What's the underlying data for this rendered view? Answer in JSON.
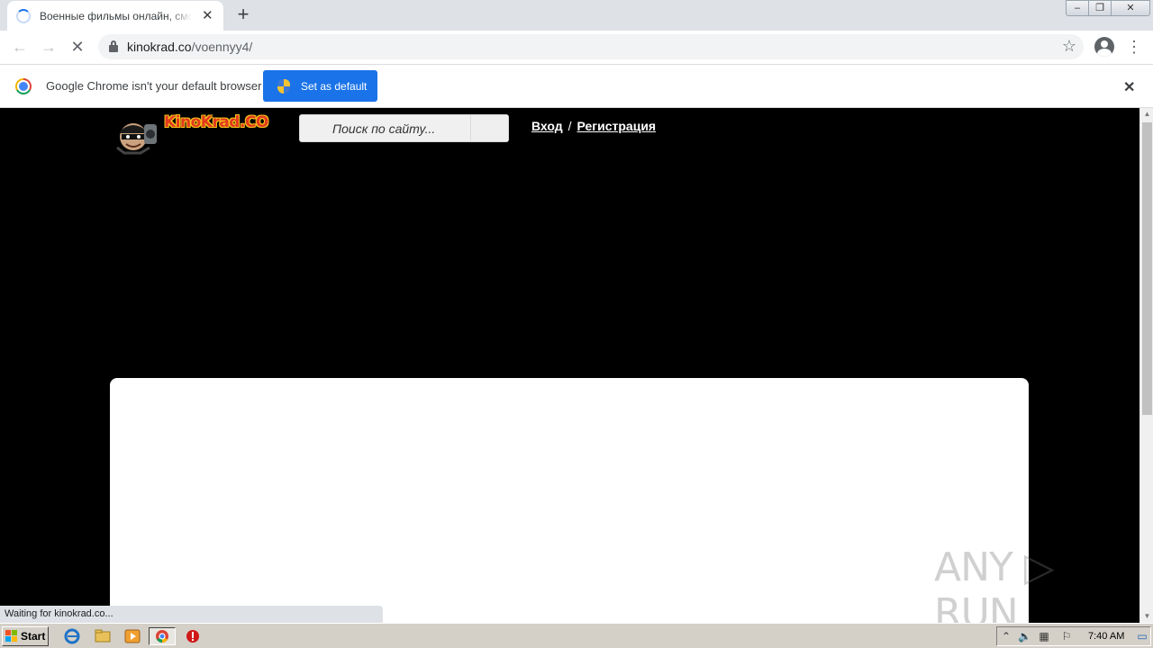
{
  "tab": {
    "title": "Военные фильмы онлайн, смотреть бесплатно",
    "close_glyph": "✕",
    "new_tab_glyph": "+"
  },
  "window_controls": {
    "minimize": "–",
    "restore": "❐",
    "close": "✕"
  },
  "toolbar": {
    "back_glyph": "←",
    "forward_glyph": "→",
    "stop_glyph": "✕",
    "url_host": "kinokrad.co",
    "url_path": "/voennyy4/",
    "bookmark_glyph": "☆",
    "menu_glyph": "⋮"
  },
  "infobar": {
    "message": "Google Chrome isn't your default browser",
    "button_label": "Set as default",
    "close_glyph": "✕"
  },
  "site": {
    "logo_text": "KinoKrad",
    "logo_suffix": ".CO",
    "search_placeholder": "Поиск по сайту...",
    "login_label": "Вход",
    "separator": "/",
    "register_label": "Регистрация",
    "watermark": "ANY ▷ RUN"
  },
  "status_text": "Waiting for kinokrad.co...",
  "taskbar": {
    "start_label": "Start",
    "clock": "7:40 AM"
  },
  "colors": {
    "accent": "#1a73e8",
    "page_background": "#000000",
    "tab_strip": "#dee1e6",
    "taskbar": "#d4d0c8"
  }
}
